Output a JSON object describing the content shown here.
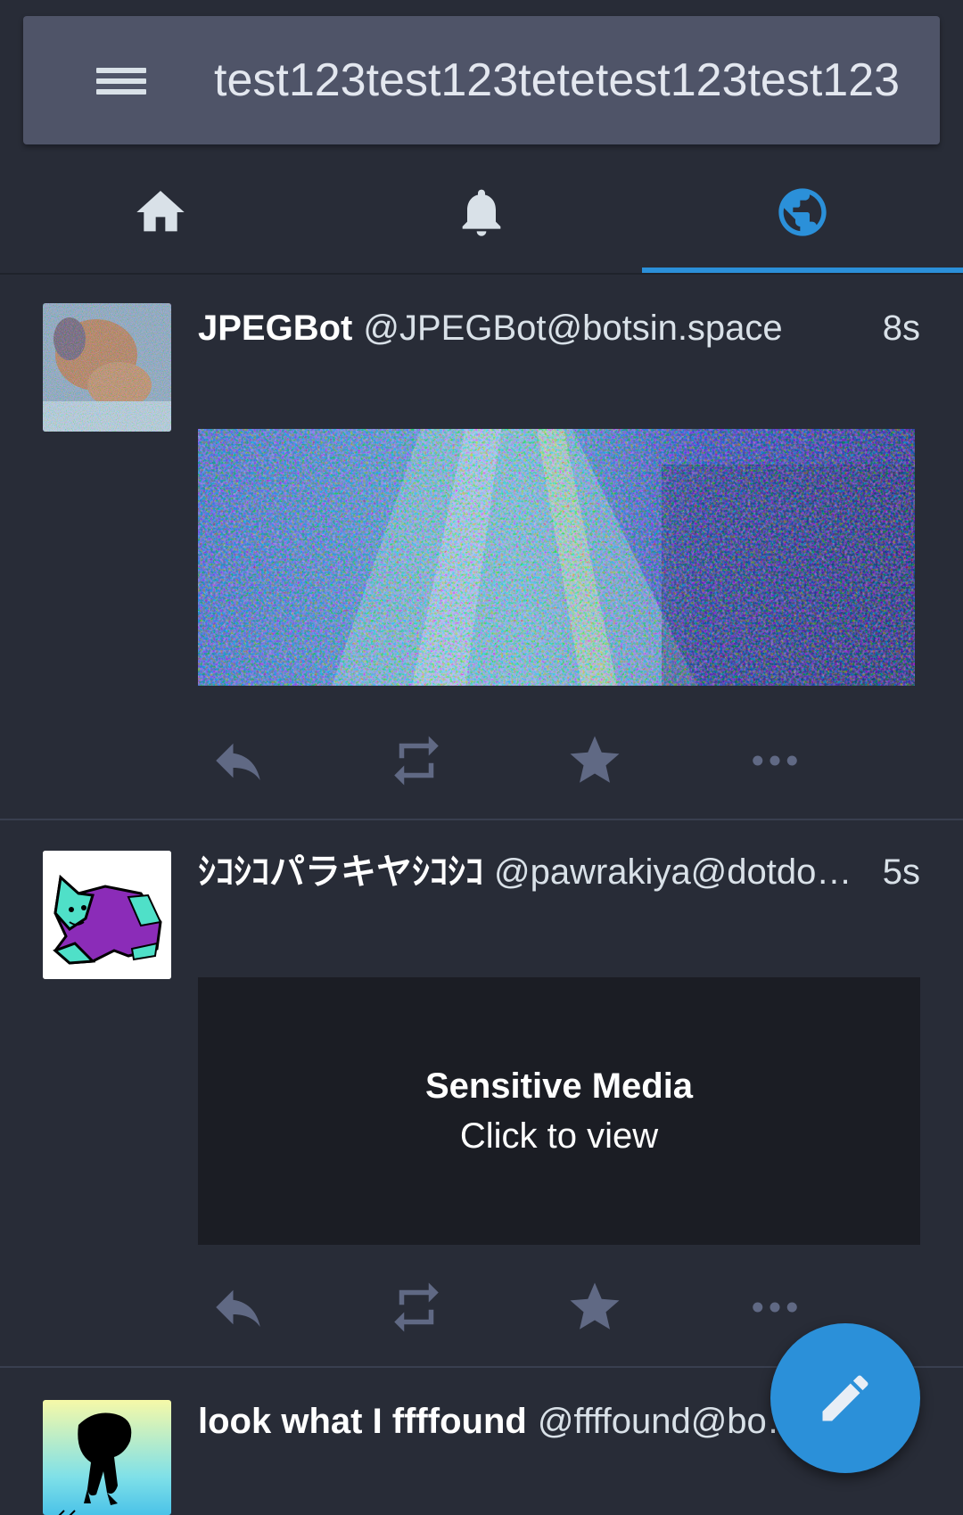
{
  "search": {
    "title": "test123test123tetetest123test123"
  },
  "tabs": [
    {
      "icon": "home-icon",
      "active": false
    },
    {
      "icon": "bell-icon",
      "active": false
    },
    {
      "icon": "globe-icon",
      "active": true
    }
  ],
  "colors": {
    "accent": "#2b90d9",
    "background": "#282c37",
    "topbar": "#4f5468",
    "action_icon": "#606984"
  },
  "statuses": [
    {
      "display_name": "JPEGBot",
      "acct": "@JPEGBot@botsin.space",
      "time": "8s",
      "media": "image"
    },
    {
      "display_name": "ｼｺｼｺパラキヤｼｺｼｺ",
      "acct": "@pawrakiya@dotdo…",
      "time": "5s",
      "media": "sensitive",
      "sensitive_title": "Sensitive Media",
      "sensitive_subtitle": "Click to view"
    },
    {
      "display_name": "look what I ffffound",
      "acct": "@ffffound@bo…",
      "time": "",
      "media": "none"
    }
  ],
  "actions": [
    "reply-icon",
    "boost-icon",
    "favourite-icon",
    "more-icon"
  ],
  "fab": {
    "icon": "compose-pencil-icon"
  }
}
